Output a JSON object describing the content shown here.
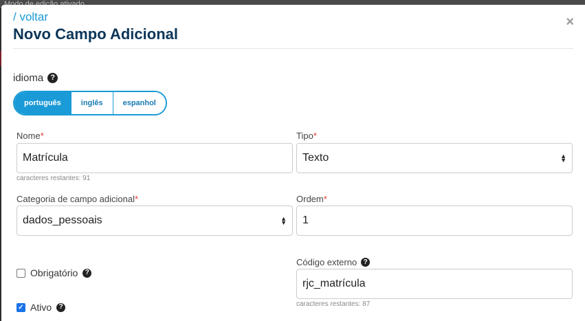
{
  "background_hint": "Modo de edição ativado",
  "header": {
    "back_link": "/ voltar",
    "title": "Novo Campo Adicional",
    "close_glyph": "×"
  },
  "language": {
    "label": "idioma",
    "options": [
      "português",
      "inglês",
      "espanhol"
    ],
    "selected": "português"
  },
  "form": {
    "nome": {
      "label": "Nome",
      "value": "Matrícula",
      "hint": "caracteres restantes: 91"
    },
    "tipo": {
      "label": "Tipo",
      "value": "Texto"
    },
    "categoria": {
      "label": "Categoria de campo adicional",
      "value": "dados_pessoais"
    },
    "ordem": {
      "label": "Ordem",
      "value": "1"
    },
    "codigo_externo": {
      "label": "Código externo",
      "value": "rjc_matrícula",
      "hint": "caracteres restantes: 87"
    },
    "obrigatorio": {
      "label": "Obrigatório",
      "checked": false
    },
    "ativo": {
      "label": "Ativo",
      "checked": true
    },
    "required_mark": "*"
  },
  "colors": {
    "accent": "#1a9ad6",
    "title": "#0b3558",
    "required": "#e53935"
  },
  "icons": {
    "help": "question-circle-icon",
    "close": "close-icon",
    "select_caret": "sort-caret-icon"
  }
}
